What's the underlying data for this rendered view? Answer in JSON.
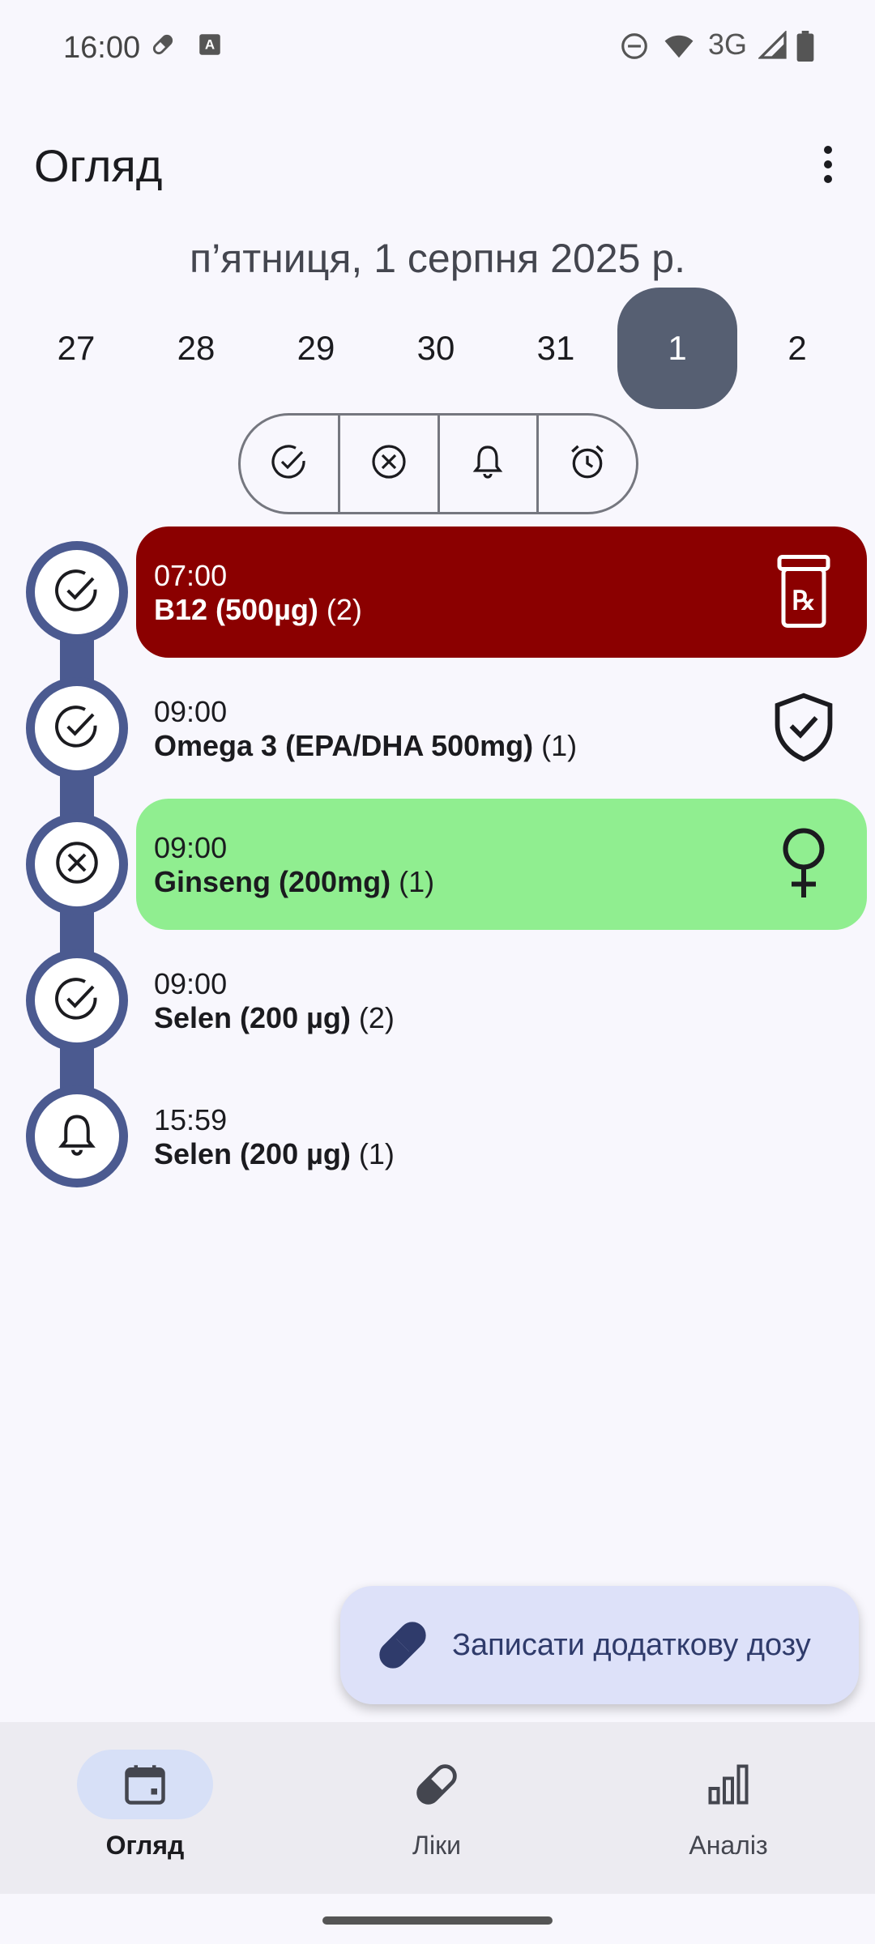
{
  "status_bar": {
    "time": "16:00",
    "network": "3G",
    "icons": [
      "pill-icon",
      "a-icon",
      "dnd-icon",
      "wifi-icon",
      "signal-icon",
      "battery-icon"
    ]
  },
  "app_bar": {
    "title": "Огляд",
    "more_icon": "more-vert-icon"
  },
  "date_heading": "п’ятниця, 1 серпня 2025 р.",
  "days": [
    {
      "label": "27",
      "selected": false
    },
    {
      "label": "28",
      "selected": false
    },
    {
      "label": "29",
      "selected": false
    },
    {
      "label": "30",
      "selected": false
    },
    {
      "label": "31",
      "selected": false
    },
    {
      "label": "1",
      "selected": true
    },
    {
      "label": "2",
      "selected": false
    }
  ],
  "filters": [
    "taken-icon",
    "skipped-icon",
    "reminder-icon",
    "alarm-icon"
  ],
  "doses": [
    {
      "time": "07:00",
      "name": "B12 (500µg)",
      "count": "(2)",
      "status": "taken",
      "style": "red",
      "icon": "prescription-bottle-icon"
    },
    {
      "time": "09:00",
      "name": "Omega 3 (EPA/DHA 500mg)",
      "count": "(1)",
      "status": "taken",
      "style": "plain",
      "icon": "shield-check-icon"
    },
    {
      "time": "09:00",
      "name": "Ginseng (200mg)",
      "count": "(1)",
      "status": "skipped",
      "style": "green",
      "icon": "female-icon"
    },
    {
      "time": "09:00",
      "name": "Selen (200 µg)",
      "count": "(2)",
      "status": "taken",
      "style": "plain",
      "icon": ""
    },
    {
      "time": "15:59",
      "name": "Selen (200 µg)",
      "count": "(1)",
      "status": "reminder",
      "style": "plain",
      "icon": ""
    }
  ],
  "fab": {
    "label": "Записати додаткову дозу",
    "icon": "pill-icon"
  },
  "nav": [
    {
      "label": "Огляд",
      "icon": "calendar-icon",
      "active": true
    },
    {
      "label": "Ліки",
      "icon": "pill-icon",
      "active": false
    },
    {
      "label": "Аналіз",
      "icon": "bar-chart-icon",
      "active": false
    }
  ],
  "colors": {
    "accent": "#4b5a90",
    "selected_day": "#565f72",
    "red_card": "#8b0000",
    "green_card": "#90ee90",
    "fab": "#dde1f9"
  }
}
